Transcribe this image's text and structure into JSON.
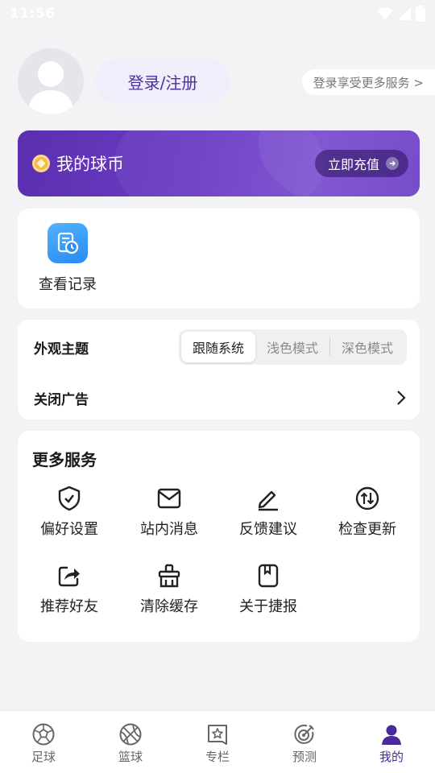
{
  "status_bar": {
    "time": "11:56"
  },
  "profile": {
    "login_label": "登录/注册",
    "promo_label": "登录享受更多服务 >"
  },
  "coin_card": {
    "title": "我的球币",
    "recharge_label": "立即充值"
  },
  "history": {
    "label": "查看记录"
  },
  "appearance": {
    "title": "外观主题",
    "options": [
      "跟随系统",
      "浅色模式",
      "深色模式"
    ],
    "selected": "跟随系统"
  },
  "ads": {
    "title": "关闭广告"
  },
  "services": {
    "title": "更多服务",
    "items": [
      {
        "label": "偏好设置",
        "icon": "shield-check-icon"
      },
      {
        "label": "站内消息",
        "icon": "envelope-icon"
      },
      {
        "label": "反馈建议",
        "icon": "edit-icon"
      },
      {
        "label": "检查更新",
        "icon": "update-arrows-icon"
      },
      {
        "label": "推荐好友",
        "icon": "share-icon"
      },
      {
        "label": "清除缓存",
        "icon": "broom-icon"
      },
      {
        "label": "关于捷报",
        "icon": "book-icon"
      }
    ]
  },
  "tabs": [
    {
      "label": "足球",
      "icon": "football-icon",
      "active": false
    },
    {
      "label": "篮球",
      "icon": "basketball-icon",
      "active": false
    },
    {
      "label": "专栏",
      "icon": "column-icon",
      "active": false
    },
    {
      "label": "预测",
      "icon": "prediction-icon",
      "active": false
    },
    {
      "label": "我的",
      "icon": "profile-icon",
      "active": true
    }
  ],
  "colors": {
    "accent": "#4a2a9a",
    "coin_card": "#6a3cc4",
    "background": "#f3f3f5"
  }
}
